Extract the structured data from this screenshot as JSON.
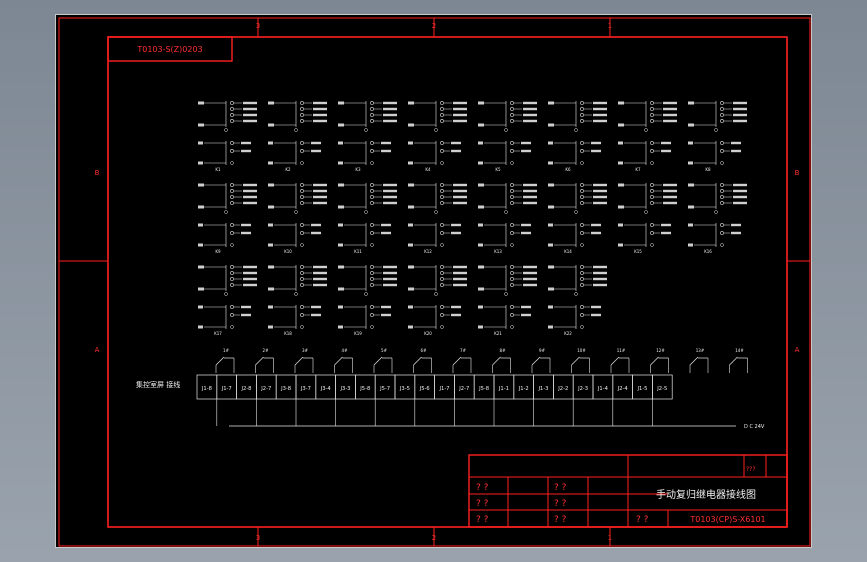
{
  "drawing_code": "T0103-S(Z)0203",
  "title_block": {
    "title": "手动复归继电器接线图",
    "drawing_number": "T0103(CP)S-X6101",
    "placeholder": "? ?",
    "placeholder_small": "???"
  },
  "zone_labels": {
    "top": [
      "3",
      "2",
      "1"
    ],
    "bottom": [
      "3",
      "2",
      "1"
    ],
    "left": [
      "B",
      "A"
    ],
    "right": [
      "B",
      "A"
    ]
  },
  "terminal_block_label": "集控室屏 接线",
  "dc_label": "D C 24V",
  "terminals": [
    "J1-8",
    "J1-7",
    "J2-8",
    "J2-7",
    "J3-8",
    "J3-7",
    "J3-4",
    "J3-3",
    "J5-8",
    "J5-7",
    "J3-5",
    "J5-6",
    "J1-7",
    "J2-7",
    "J5-8",
    "J1-1",
    "J1-2",
    "J1-3",
    "J2-2",
    "J2-3",
    "J1-4",
    "J2-4",
    "J1-5",
    "J2-5"
  ],
  "switch_labels": [
    "1#",
    "2#",
    "3#",
    "4#",
    "5#",
    "6#",
    "7#",
    "8#",
    "9#",
    "10#",
    "11#",
    "12#",
    "13#",
    "14#"
  ],
  "relay_labels": [
    "K1",
    "K2",
    "K3",
    "K4",
    "K5",
    "K6",
    "K7",
    "K8",
    "K9",
    "K10",
    "K11",
    "K12",
    "K13",
    "K14",
    "K15",
    "K16",
    "K17",
    "K18",
    "K19",
    "K20",
    "K21",
    "K22"
  ]
}
